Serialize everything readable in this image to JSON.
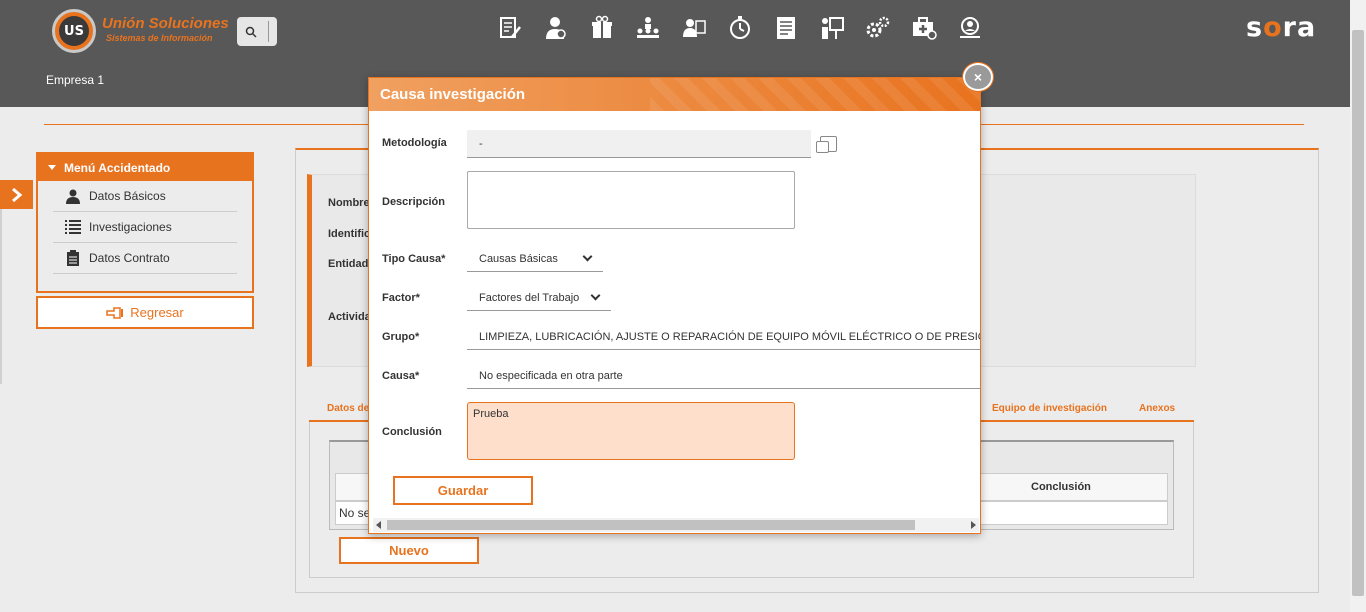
{
  "header": {
    "logo_title": "Unión Soluciones",
    "logo_subtitle": "Sistemas de Información",
    "logo_badge": "US",
    "brand_left": "s",
    "brand_accent": "o",
    "brand_right": "ra",
    "company": "Empresa 1",
    "nav_icons": [
      "document-edit-icon",
      "user-shield-icon",
      "gift-icon",
      "org-chart-icon",
      "user-assign-icon",
      "stopwatch-icon",
      "form-list-icon",
      "presentation-icon",
      "gears-icon",
      "medkit-icon",
      "search-people-icon"
    ]
  },
  "side_menu": {
    "title": "Menú Accidentado",
    "items": [
      {
        "label": "Datos Básicos",
        "icon": "user-icon"
      },
      {
        "label": "Investigaciones",
        "icon": "list-icon"
      },
      {
        "label": "Datos Contrato",
        "icon": "clipboard-icon"
      }
    ],
    "back_label": "Regresar"
  },
  "info_card": {
    "labels": [
      "Nombre",
      "Identific",
      "Entidad",
      "Activida"
    ]
  },
  "tabs": {
    "first": "Datos de",
    "team": "Equipo de investigación",
    "annexes": "Anexos"
  },
  "table": {
    "header_conclusion": "Conclusión",
    "empty_text": "No se"
  },
  "new_button": "Nuevo",
  "modal": {
    "title": "Causa investigación",
    "close_label": "×",
    "fields": {
      "metodologia_label": "Metodología",
      "metodologia_value": "-",
      "descripcion_label": "Descripción",
      "tipo_causa_label": "Tipo Causa*",
      "tipo_causa_value": "Causas Básicas",
      "factor_label": "Factor*",
      "factor_value": "Factores del Trabajo",
      "grupo_label": "Grupo*",
      "grupo_value": "LIMPIEZA, LUBRICACIÓN, AJUSTE O REPARACIÓN DE EQUIPO MÓVIL ELÉCTRICO O DE PRESIÓN",
      "causa_label": "Causa*",
      "causa_value": "No especificada en otra parte",
      "conclusion_label": "Conclusión",
      "conclusion_value": "Prueba"
    },
    "save_label": "Guardar"
  },
  "colors": {
    "accent": "#e8731f",
    "header_bg": "#585858",
    "conclusion_bg": "#fddfcc"
  }
}
